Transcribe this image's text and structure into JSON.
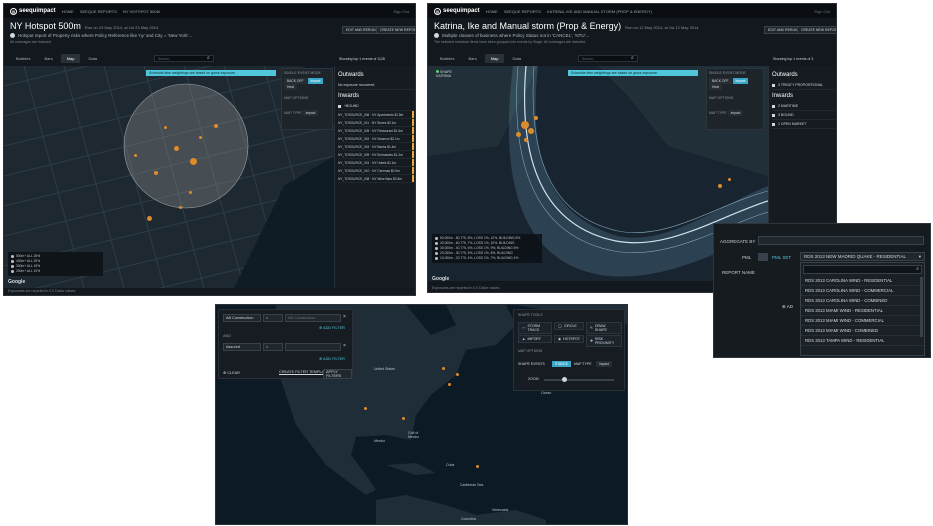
{
  "panel1": {
    "logo_name": "seequimpact",
    "nav": [
      "HOME",
      "SEEQUE REPORTS",
      "NY HOTSPOT 500M"
    ],
    "top_right": "Sign Out",
    "title": "NY Hotspot 500m",
    "title_meta": "Run on 23 May 2014, at 1st 23 May 2014",
    "subtitle": "Hotspot report of Property risks where Policy Reference like 'ny' and City = 'New York'...",
    "note": "All coverages are included",
    "btn_edit": "EDIT AND RERUN",
    "btn_new": "CREATE NEW REPORT",
    "tabs": [
      "Bubbles",
      "Bars",
      "Map",
      "Data"
    ],
    "active_tab": "Map",
    "search_placeholder": "Search...",
    "showing": "Showing top 1 events of 1128",
    "banner": "Schedule item weightings are based on gross exposure.",
    "ctrl_single_event": "SINGLE EVENT MODE",
    "ctrl_back_off": "BACK OFF",
    "ctrl_impact": "Impact",
    "ctrl_heat": "Heat",
    "ctrl_map_options": "MAP OPTIONS",
    "ctrl_map_type": "MAP TYPE",
    "ctrl_map_type_val": "Impact",
    "outwards": "Outwards",
    "outwards_item": "No exposure recovered",
    "inwards": "Inwards",
    "inwards_item": "+BOUND",
    "policies": [
      {
        "name": "NY_TOSOURCE_006",
        "sub": "NY Apartments",
        "amt": "$1.5m"
      },
      {
        "name": "NY_TOSOURCE_011",
        "sub": "NY Stores",
        "amt": "$3.1m"
      },
      {
        "name": "NY_TOSOURCE_005",
        "sub": "NY Restaurant",
        "amt": "$1.6m"
      },
      {
        "name": "NY_TOSOURCE_002",
        "sub": "NY Museum",
        "amt": "$2.1m"
      },
      {
        "name": "NY_TOSOURCE_003",
        "sub": "NY Banks",
        "amt": "$1.4m"
      },
      {
        "name": "NY_TOSOURCE_009",
        "sub": "NY Embassies",
        "amt": "$1.2m"
      },
      {
        "name": "NY_TOSOURCE_001",
        "sub": "NY Hotels",
        "amt": "$1.1m"
      },
      {
        "name": "NY_TOSOURCE_010",
        "sub": "NY Cinemas",
        "amt": "$0.9m"
      },
      {
        "name": "NY_TOSOURCE_008",
        "sub": "NY Wine Bars",
        "amt": "$0.8m"
      }
    ],
    "legend": [
      "500m+ ALL 25%",
      "400m+ ALL 20%",
      "300m+ ALL 15%",
      "200m+ ALL 10%"
    ],
    "google": "Google",
    "footnote": "Exposures are reported in 0.0 Dollar values"
  },
  "panel2": {
    "logo_name": "seequimpact",
    "nav": [
      "HOME",
      "SEEQUE REPORTS",
      "KATRINA, IKE AND MANUAL STORM (PROP & ENERGY)"
    ],
    "top_right": "Sign Out",
    "title": "Katrina, Ike and Manual storm (Prop & Energy)",
    "title_meta": "Run on 12 May 2014, at 1st 12 May 2014",
    "subtitle": "Multiple classes of business where Policy Status not in 'CANCEL', 'NTU'...",
    "note": "The selected schedule items have been grouped into events by Stage. All coverages are included.",
    "btn_edit": "EDIT AND RERUN",
    "btn_new": "CREATE NEW REPORT",
    "tabs": [
      "Bubbles",
      "Bars",
      "Map",
      "Data"
    ],
    "active_tab": "Map",
    "search_placeholder": "Search...",
    "showing": "Showing top 1 events of 3",
    "banner": "Schedule item weightings are based on gross exposure.",
    "layer_label": "SHAPE",
    "layer_value": "KATRINA",
    "ctrl_single_event": "SINGLE EVENT MODE",
    "ctrl_back_off": "BACK OFF",
    "ctrl_impact": "Impact",
    "ctrl_heat": "Heat",
    "ctrl_map_options": "MAP OPTIONS",
    "ctrl_map_type": "MAP TYPE",
    "ctrl_map_type_val": "Impact",
    "outwards": "Outwards",
    "outwards_item": "3 TREATY PROPORTIONAL",
    "inwards": "Inwards",
    "inwards_items": [
      "2 MARITIME",
      "3 BOUND",
      "1 OPEN MARKET"
    ],
    "legend": [
      "50,000m - 80,775, 8%, LOSS 1%, 12%, BUILDING 8%",
      "40,000m - 60,775, 7%, LOSS 1%, 10%, BUILDING",
      "30,000m - 40,775, 6%, LOSS 1%, 9%, BUILDING 6%",
      "20,000m - 30,775, 5%, LOSS 1%, 8%, BUILDING",
      "10,000m - 20,775, 4%, LOSS 1%, 7%, BUILDING 4%"
    ],
    "google": "Google",
    "footnote": "Exposures are reported in 0.0 Dollar values"
  },
  "popup": {
    "aggregate_by": "AGGREGATE BY",
    "pml": "PML",
    "pml_set": "PML SET",
    "report_name": "REPORT NAME",
    "add": "AD",
    "selected": "RDS 2013 NEW MADRID QUAKE - RESIDENTIAL",
    "options": [
      "RDS 2013 CAROLINA WIND - RESIDENTIAL",
      "RDS 2013 CAROLINA WIND - COMMERCIAL",
      "RDS 2013 CAROLINA WIND - COMBINED",
      "RDS 2013 MIAMI WIND - RESIDENTIAL",
      "RDS 2013 MIAMI WIND - COMMERCIAL",
      "RDS 2013 MIAMI WIND - COMBINED",
      "RDS 2013 TAMPA WIND - RESIDENTIAL"
    ]
  },
  "panel3": {
    "filter1_field": "AB Construction",
    "filter1_op": "=",
    "filter1_val": "AB Construction",
    "add_filter": "ADD FILTER",
    "and_label": "AND",
    "filter2_field": "Assured",
    "filter2_op": "=",
    "clear": "CLEAR",
    "create_template": "CREATE FILTER TEMPLATE",
    "apply": "APPLY FILTERS",
    "tools_title": "SHAPE TOOLS",
    "tools": [
      "STORM TRACK",
      "CIRCLE",
      "DRAW SHAPE",
      "IMPORT",
      "HOTSPOT",
      "RISK PROXIMITY"
    ],
    "map_options": "MAP OPTIONS",
    "shape_events": "SHAPE EVENTS",
    "shape_events_val": "STANCE",
    "map_type": "MAP TYPE",
    "map_type_val": "Impact",
    "zoom": "ZOOM",
    "places": [
      "United States",
      "North Atlantic Ocean",
      "Gulf of Mexico",
      "Mexico",
      "Cuba",
      "Caribbean Sea",
      "Venezuela",
      "Colombia"
    ]
  }
}
